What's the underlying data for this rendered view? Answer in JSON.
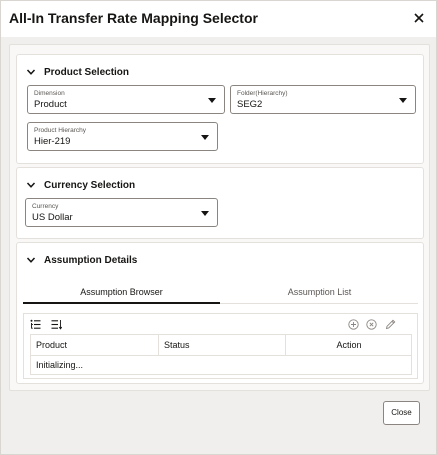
{
  "dialog": {
    "title": "All-In Transfer Rate Mapping Selector",
    "close_icon": "close-icon"
  },
  "product_selection": {
    "title": "Product Selection",
    "dimension": {
      "label": "Dimension",
      "value": "Product"
    },
    "folder": {
      "label": "Folder(Hierarchy)",
      "value": "SEG2"
    },
    "hierarchy": {
      "label": "Product Hierarchy",
      "value": "Hier-219"
    }
  },
  "currency_selection": {
    "title": "Currency Selection",
    "currency": {
      "label": "Currency",
      "value": "US Dollar"
    }
  },
  "assumption_details": {
    "title": "Assumption Details",
    "tabs": [
      {
        "label": "Assumption Browser",
        "active": true
      },
      {
        "label": "Assumption List",
        "active": false
      }
    ],
    "toolbar_icons": [
      "expand-all-icon",
      "collapse-all-icon",
      "add-icon",
      "remove-icon",
      "edit-icon"
    ],
    "columns": [
      "Product",
      "Status",
      "Action"
    ],
    "status_text": "Initializing..."
  },
  "footer": {
    "close_label": "Close"
  }
}
